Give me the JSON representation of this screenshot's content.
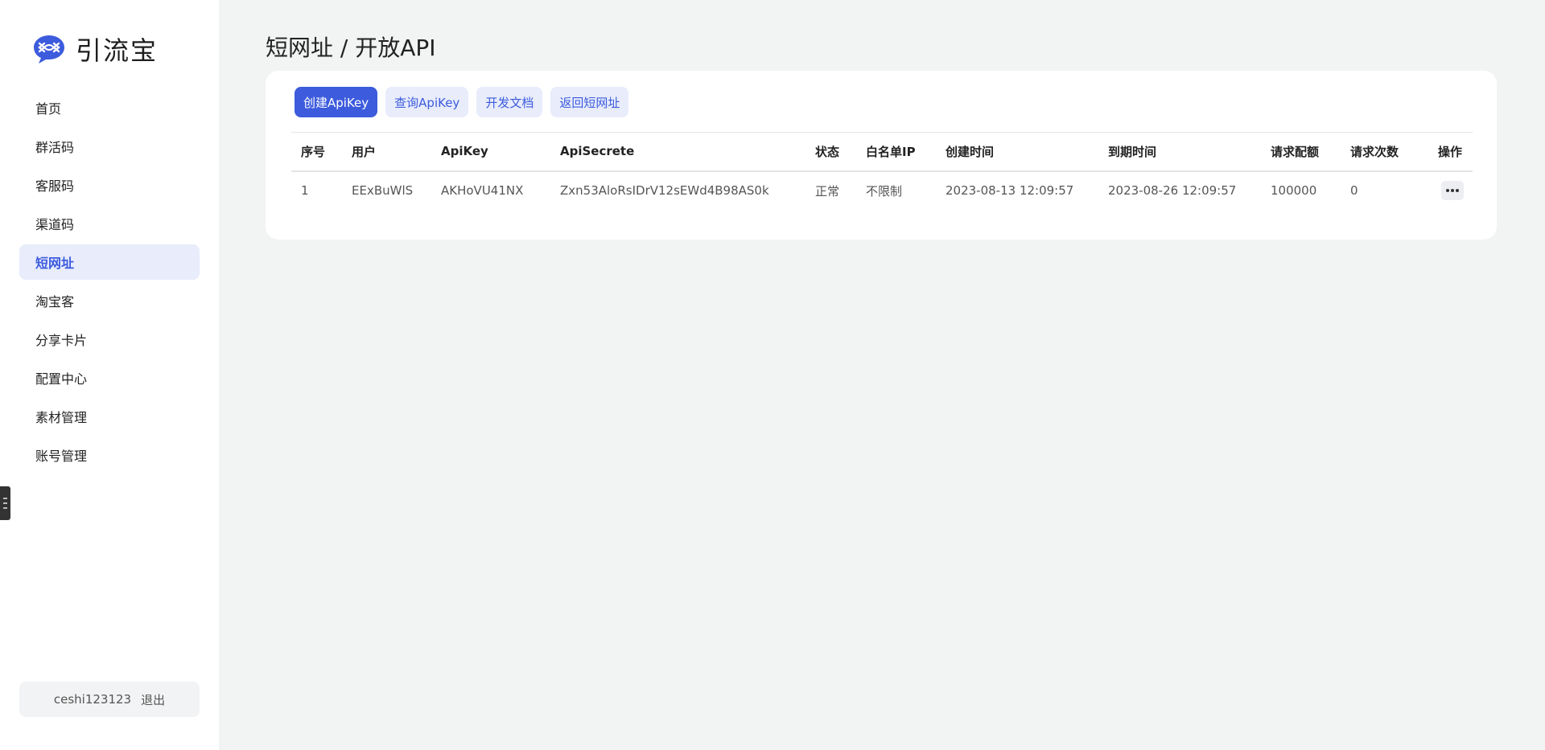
{
  "brand": {
    "name": "引流宝",
    "accent": "#3c5bdd"
  },
  "sidebar": {
    "items": [
      {
        "label": "首页",
        "active": false
      },
      {
        "label": "群活码",
        "active": false
      },
      {
        "label": "客服码",
        "active": false
      },
      {
        "label": "渠道码",
        "active": false
      },
      {
        "label": "短网址",
        "active": true
      },
      {
        "label": "淘宝客",
        "active": false
      },
      {
        "label": "分享卡片",
        "active": false
      },
      {
        "label": "配置中心",
        "active": false
      },
      {
        "label": "素材管理",
        "active": false
      },
      {
        "label": "账号管理",
        "active": false
      }
    ],
    "user": {
      "name": "ceshi123123",
      "logout_label": "退出"
    }
  },
  "page": {
    "title": "短网址 / 开放API"
  },
  "toolbar": {
    "create_label": "创建ApiKey",
    "query_label": "查询ApiKey",
    "docs_label": "开发文档",
    "back_label": "返回短网址"
  },
  "table": {
    "headers": [
      "序号",
      "用户",
      "ApiKey",
      "ApiSecrete",
      "状态",
      "白名单IP",
      "创建时间",
      "到期时间",
      "请求配额",
      "请求次数",
      "操作"
    ],
    "rows": [
      [
        "1",
        "EExBuWlS",
        "AKHoVU41NX",
        "Zxn53AloRsIDrV12sEWd4B98AS0k",
        "正常",
        "不限制",
        "2023-08-13 12:09:57",
        "2023-08-26 12:09:57",
        "100000",
        "0"
      ]
    ],
    "action_icon": "more-horizontal-icon"
  }
}
